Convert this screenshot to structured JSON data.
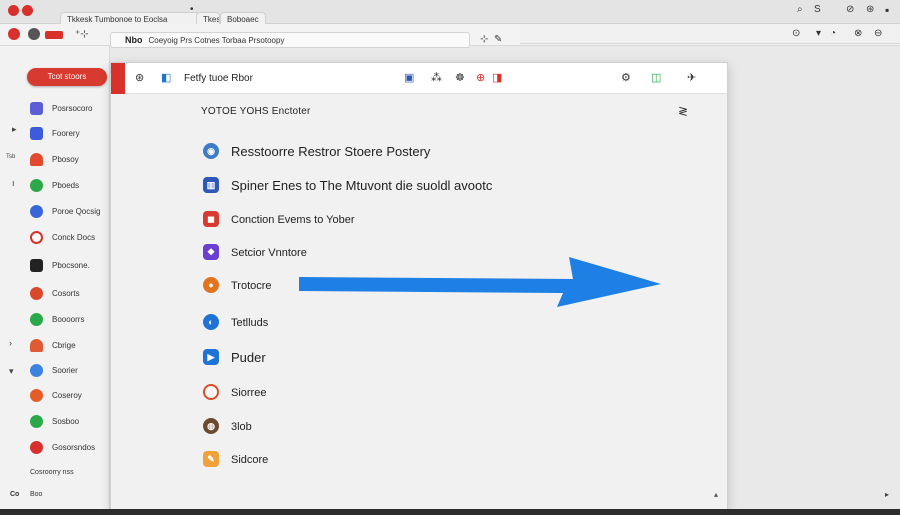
{
  "chrome": {
    "tabs": [
      "Tkkesk Tumbonoe to Eoclsa",
      "Tkes",
      "Boboaec"
    ],
    "toolbar_left": "⁺⊹",
    "omnibox_prefix": "Nbo",
    "omnibox_text": "Coeyoig Prs Cotnes Torbaa Prsotoopy",
    "right_controls": [
      "⌕",
      "S",
      "⊘",
      "⊛"
    ],
    "right_bar_controls": [
      "⊙",
      "▾",
      "◔",
      "⊗",
      "⊖"
    ]
  },
  "sidebar": {
    "compose_label": "Tcot stoors",
    "items": [
      {
        "label": "Posrsocoro",
        "color": "#5a5cd6"
      },
      {
        "label": "Foorery",
        "color": "#3c5ad9"
      },
      {
        "label": "Pbosoy",
        "color": "#e24a2f"
      },
      {
        "label": "Pboeds",
        "color": "#2aa84a"
      },
      {
        "label": "Poroe Qocsig",
        "color": "#3865d8"
      },
      {
        "label": "Conck Docs",
        "color": "#d8312c"
      },
      {
        "label": "Pbocsone.",
        "color": "#222222"
      },
      {
        "label": "Cosorts",
        "color": "#d8482d"
      },
      {
        "label": "Boooorrs",
        "color": "#2aa84a"
      },
      {
        "label": "Cbrige",
        "color": "#e05a33"
      },
      {
        "label": "Soorier",
        "color": "#3c84e0"
      },
      {
        "label": "Coseroy",
        "color": "#e65b2a"
      },
      {
        "label": "Sosboo",
        "color": "#2aa84a"
      },
      {
        "label": "Gosorsndos",
        "color": "#d8312c"
      }
    ],
    "footer_1": "Cosroorry nss",
    "footer_2": "Boo",
    "footer_3": "Co"
  },
  "dialog": {
    "title": "Fetfy tuoe Rbor",
    "subtitle": "YOTOE YOHS Enctoter",
    "menu_glyph": "≷",
    "header_icons": [
      "⊛",
      "◧",
      "⁂",
      "☸",
      "⊕",
      "◨"
    ],
    "header_right_icons": [
      "⚙",
      "◫",
      "✈"
    ],
    "items": [
      {
        "label": "Resstoorre Restror Stoere Postery",
        "icon": "◉",
        "color": "#3d7cc9"
      },
      {
        "label": "Spiner Enes to The Mtuvont die suoldl avootc",
        "icon": "▥",
        "color": "#2e58b8"
      },
      {
        "label": "Conction Evems to Yober",
        "icon": "◼",
        "color": "#d93a30"
      },
      {
        "label": "Setcior Vnntore",
        "icon": "❖",
        "color": "#6a3fcf"
      },
      {
        "label": "Trotocre",
        "icon": "●",
        "color": "#e2741f"
      },
      {
        "label": "Tetlluds",
        "icon": "◐",
        "color": "#1f73d6"
      },
      {
        "label": "Puder",
        "icon": "▶",
        "color": "#1f73d6"
      },
      {
        "label": "Siorree",
        "icon": "◌",
        "color": "#e04a2a"
      },
      {
        "label": "3lob",
        "icon": "◍",
        "color": "#6b4a30"
      },
      {
        "label": "Sidcore",
        "icon": "✎",
        "color": "#f0a23a"
      }
    ],
    "resize_glyph": "▴"
  },
  "arrow": {
    "color": "#1e7fe5"
  }
}
